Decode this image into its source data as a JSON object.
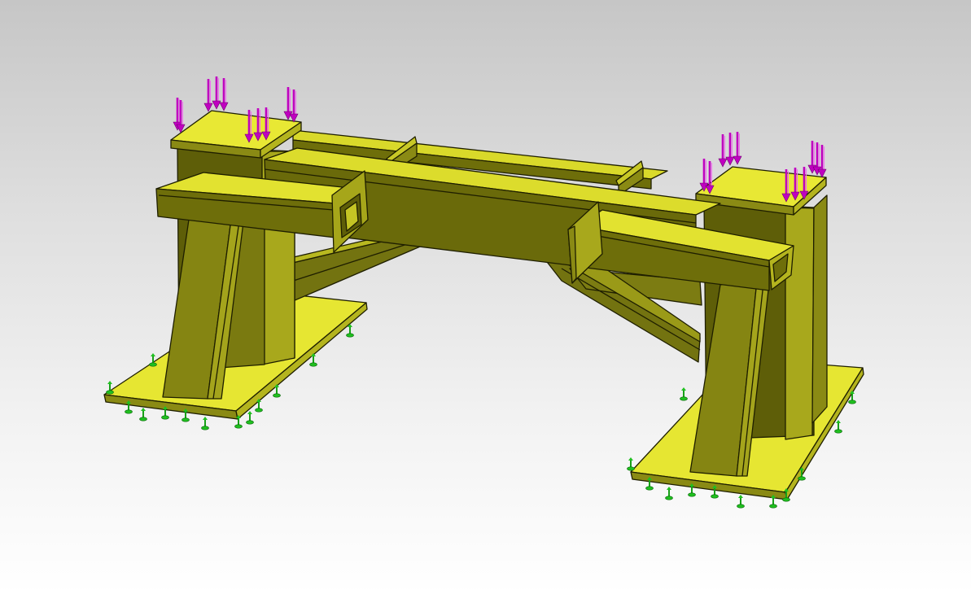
{
  "viewport": {
    "label": "",
    "background_top": "#c6c6c6",
    "background_bottom": "#ffffff"
  },
  "model": {
    "name": "",
    "face_color_top": "#e8e832",
    "face_color_front": "#6e6e0a",
    "face_color_side": "#b2b21e",
    "edge_color": "#1e1e00"
  },
  "loads": {
    "type": "downward-force-arrows",
    "color": "#c000c0",
    "icon": "arrow-down-icon"
  },
  "fixtures": {
    "type": "fixed-support-markers",
    "color": "#18b018",
    "icon": "anchor-pin-icon"
  }
}
